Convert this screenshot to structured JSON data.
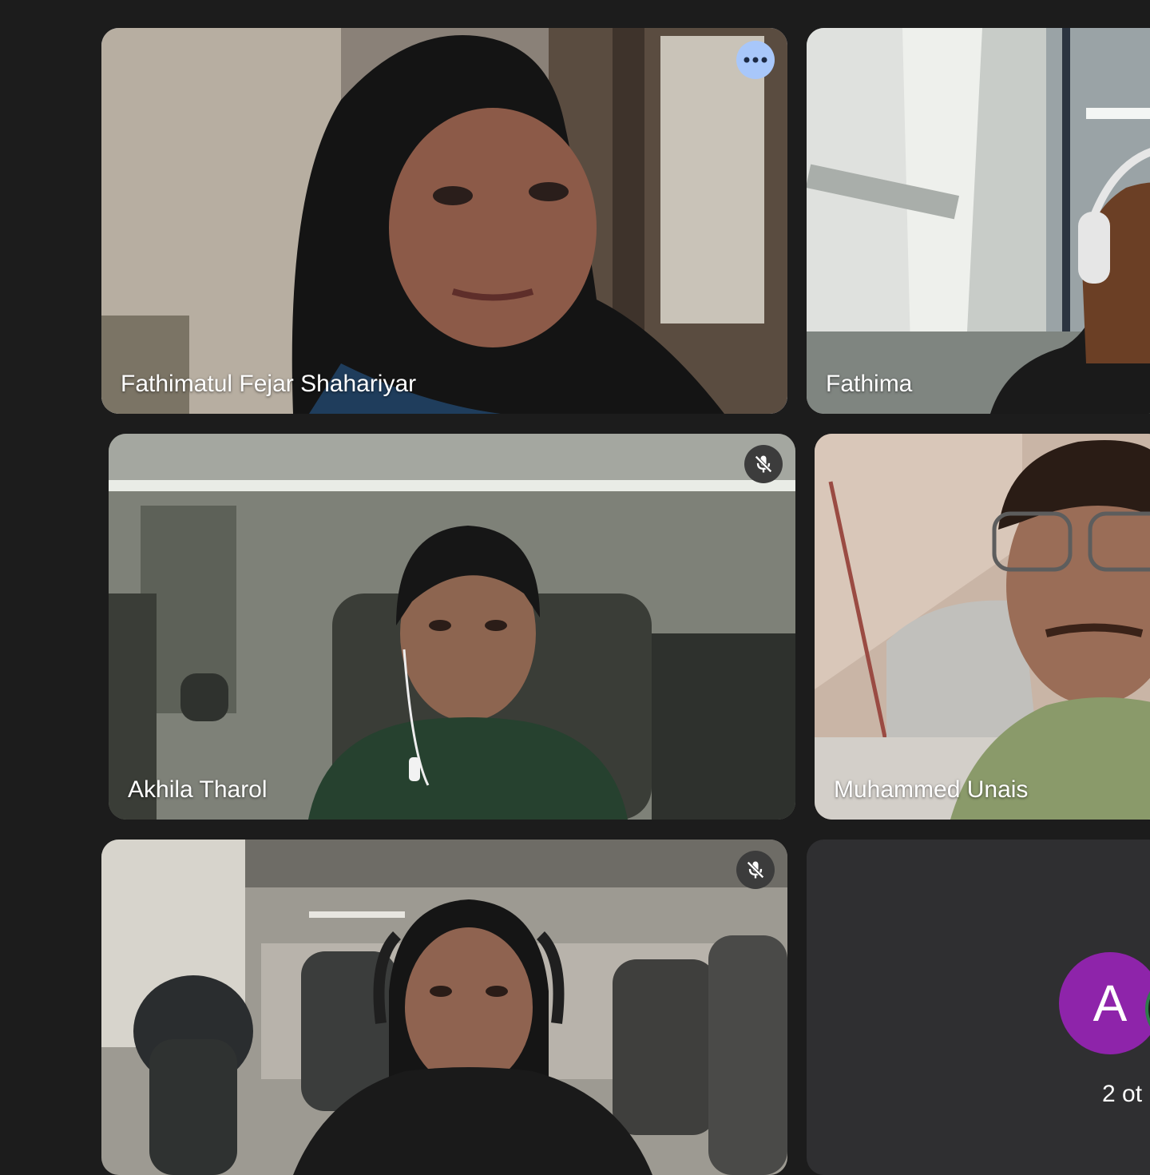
{
  "colors": {
    "background": "#1c1c1c",
    "speaking_outline": "#a8c7fa",
    "avatar_purple": "#8e24aa",
    "others_tile": "#2f2f31"
  },
  "tiles": [
    {
      "name": "Fathimatul Fejar Shahariyar",
      "speaking": true,
      "muted": false,
      "icon": "more-options-icon"
    },
    {
      "name": "Fathima",
      "speaking": false,
      "muted": false
    },
    {
      "name": "Akhila Tharol",
      "speaking": false,
      "muted": true,
      "icon": "mic-off-icon"
    },
    {
      "name": "Muhammed Unais",
      "speaking": false,
      "muted": false
    },
    {
      "name": "",
      "speaking": false,
      "muted": true,
      "icon": "mic-off-icon"
    }
  ],
  "others": {
    "avatar_letter": "A",
    "label": "2 ot"
  }
}
